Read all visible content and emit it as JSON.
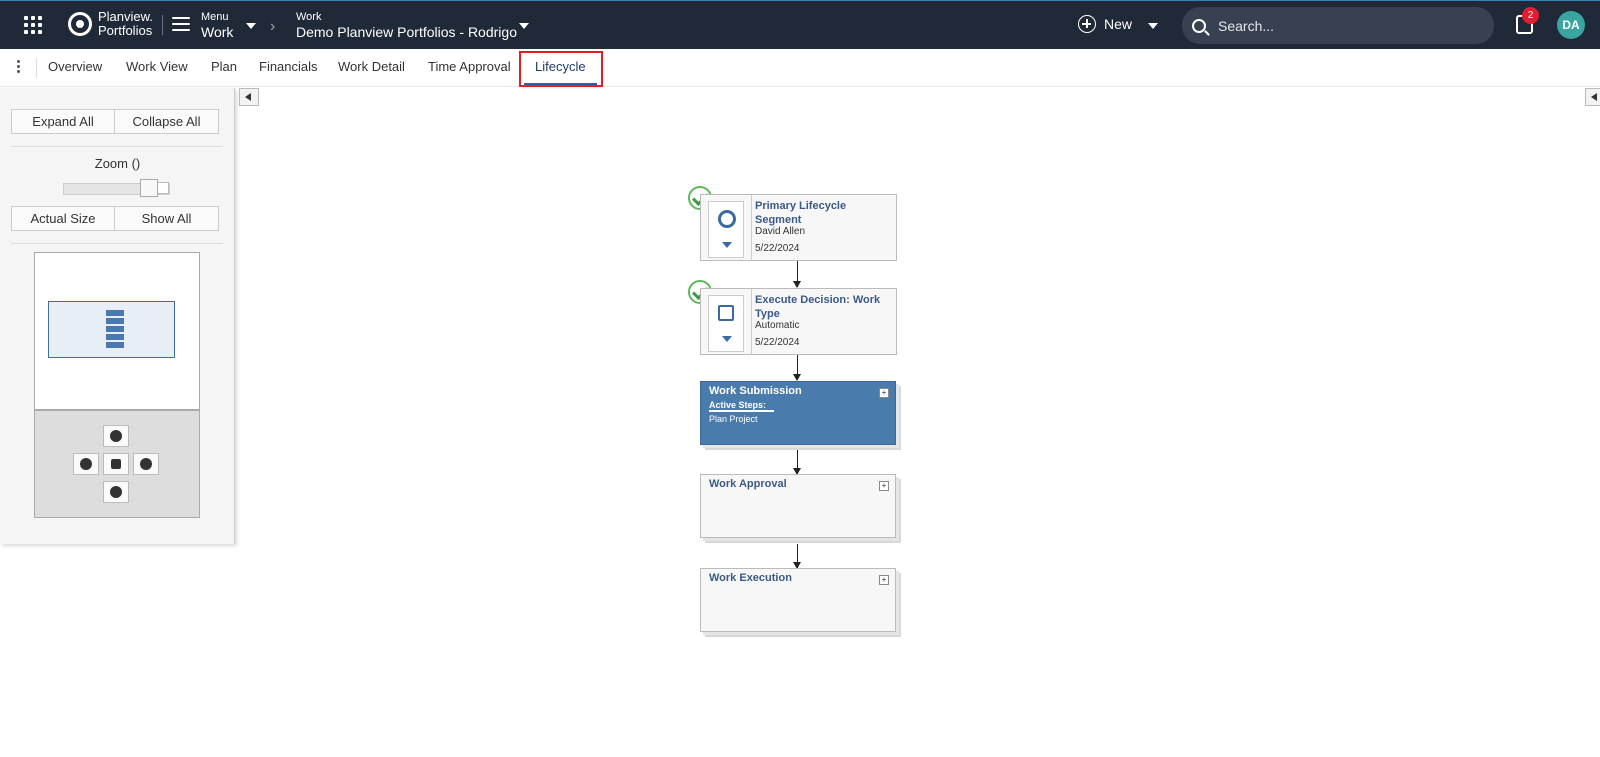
{
  "header": {
    "logo_line1": "Planview.",
    "logo_line2": "Portfolios",
    "menu_small": "Menu",
    "menu_big": "Work",
    "work_small": "Work",
    "work_big": "Demo Planview Portfolios - Rodrigo",
    "new_label": "New",
    "search_placeholder": "Search...",
    "notification_count": "2",
    "avatar_initials": "DA"
  },
  "tabs": [
    {
      "label": "Overview"
    },
    {
      "label": "Work View"
    },
    {
      "label": "Plan"
    },
    {
      "label": "Financials"
    },
    {
      "label": "Work Detail"
    },
    {
      "label": "Time Approval"
    },
    {
      "label": "Lifecycle",
      "active": true
    }
  ],
  "left_panel": {
    "expand_all": "Expand All",
    "collapse_all": "Collapse All",
    "zoom_label": "Zoom ()",
    "actual_size": "Actual Size",
    "show_all": "Show All"
  },
  "lifecycle": {
    "steps": [
      {
        "title": "Primary Lifecycle Segment",
        "person": "David Allen",
        "date": "5/22/2024",
        "completed": true
      },
      {
        "title": "Execute Decision: Work Type",
        "person": "Automatic",
        "date": "5/22/2024",
        "completed": true
      }
    ],
    "phases": [
      {
        "title": "Work Submission",
        "active": true,
        "active_steps_label": "Active Steps:",
        "step": "Plan Project"
      },
      {
        "title": "Work Approval",
        "active": false
      },
      {
        "title": "Work Execution",
        "active": false
      }
    ]
  },
  "colors": {
    "topbar": "#1f2937",
    "active_phase": "#4a7bad",
    "highlight": "#e41c24",
    "check": "#5cb85c"
  }
}
